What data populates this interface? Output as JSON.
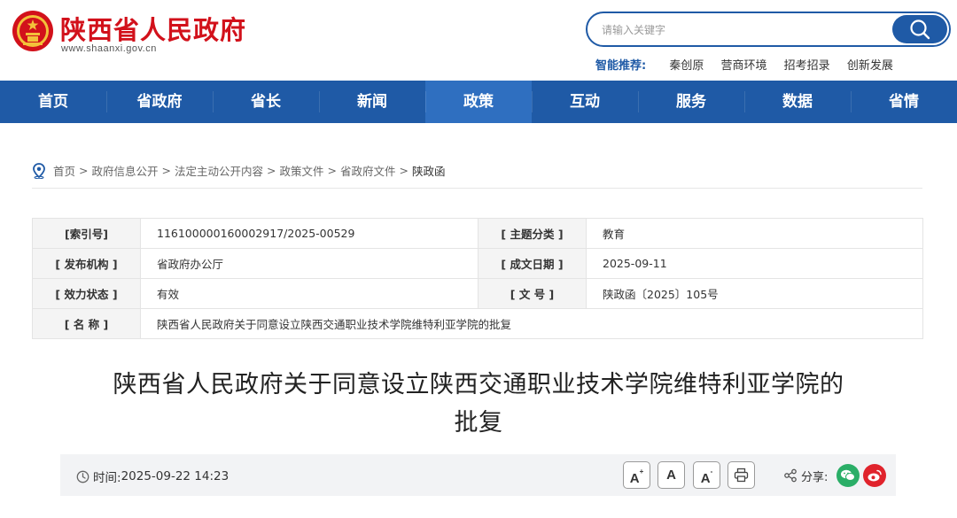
{
  "header": {
    "site_name": "陕西省人民政府",
    "site_url": "www.shaanxi.gov.cn",
    "search_placeholder": "请输入关键字",
    "smart_label": "智能推荐:",
    "smart_links": [
      "秦创原",
      "营商环境",
      "招考招录",
      "创新发展"
    ]
  },
  "nav": {
    "items": [
      "首页",
      "省政府",
      "省长",
      "新闻",
      "政策",
      "互动",
      "服务",
      "数据",
      "省情"
    ],
    "active_index": 4
  },
  "breadcrumb": {
    "items": [
      "首页",
      "政府信息公开",
      "法定主动公开内容",
      "政策文件",
      "省政府文件"
    ],
    "current": "陕政函",
    "separator": ">"
  },
  "meta": {
    "index_label": "[索引号]",
    "index_value": "116100000160002917/2025-00529",
    "topic_label": "[ 主题分类 ]",
    "topic_value": "教育",
    "publisher_label": "[ 发布机构 ]",
    "publisher_value": "省政府办公厅",
    "date_label": "[ 成文日期 ]",
    "date_value": "2025-09-11",
    "status_label": "[ 效力状态 ]",
    "status_value": "有效",
    "docno_label": "[ 文 号 ]",
    "docno_value": "陕政函〔2025〕105号",
    "name_label": "[ 名 称 ]",
    "name_value": "陕西省人民政府关于同意设立陕西交通职业技术学院维特利亚学院的批复"
  },
  "article": {
    "title_line1": "陕西省人民政府关于同意设立陕西交通职业技术学院维特利亚学院的",
    "title_line2": "批复"
  },
  "toolbar": {
    "time_label": "时间:",
    "time_value": "2025-09-22 14:23",
    "font_large": "A",
    "font_normal": "A",
    "font_small": "A",
    "share_label": "分享:"
  },
  "colors": {
    "brand_red": "#d2111b",
    "nav_blue": "#1f5aa6",
    "nav_active": "#2f6fc0",
    "wechat_green": "#2aae67",
    "weibo_red": "#e0232c"
  }
}
